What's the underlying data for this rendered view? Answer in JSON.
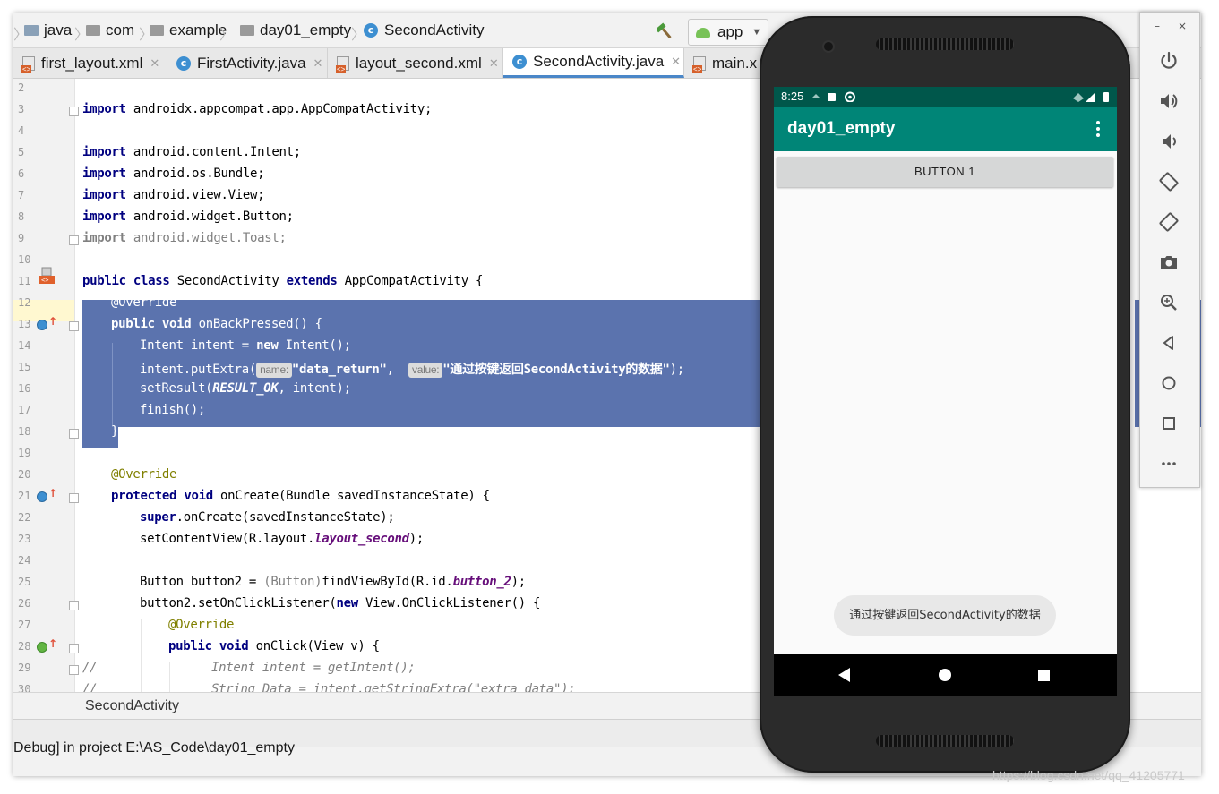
{
  "breadcrumb": [
    "java",
    "com",
    "example",
    "day01_empty",
    "SecondActivity"
  ],
  "run_config": "app",
  "tabs": [
    {
      "label": "first_layout.xml",
      "type": "xml"
    },
    {
      "label": "FirstActivity.java",
      "type": "class"
    },
    {
      "label": "layout_second.xml",
      "type": "xml"
    },
    {
      "label": "SecondActivity.java",
      "type": "class",
      "active": true
    },
    {
      "label": "main.x",
      "type": "xml"
    }
  ],
  "code": {
    "line_numbers": [
      "2",
      "3",
      "4",
      "5",
      "6",
      "7",
      "8",
      "9",
      "10",
      "11",
      "12",
      "13",
      "14",
      "15",
      "16",
      "17",
      "18",
      "19",
      "20",
      "21",
      "22",
      "23",
      "24",
      "25",
      "26",
      "27",
      "28",
      "29",
      "30"
    ],
    "l3": [
      "import",
      " androidx.appcompat.app.AppCompatActivity;"
    ],
    "l5": [
      "import",
      " android.content.Intent;"
    ],
    "l6": [
      "import",
      " android.os.Bundle;"
    ],
    "l7": [
      "import",
      " android.view.View;"
    ],
    "l8": [
      "import",
      " android.widget.Button;"
    ],
    "l9": [
      "import",
      " android.widget.Toast;"
    ],
    "l11": [
      "public",
      " ",
      "class",
      " SecondActivity ",
      "extends",
      " AppCompatActivity {"
    ],
    "l12": [
      "@Override"
    ],
    "l13": [
      "public",
      " ",
      "void",
      " onBackPressed() {"
    ],
    "l14": [
      "Intent intent = ",
      "new",
      " Intent();"
    ],
    "l15": [
      "intent.putExtra(",
      "name:",
      "\"data_return\"",
      ",  ",
      "value:",
      "\"通过按键返回SecondActivity的数据\"",
      ");"
    ],
    "l16": [
      "setResult(",
      "RESULT_OK",
      ", intent);"
    ],
    "l17": [
      "finish();"
    ],
    "l18": [
      "}"
    ],
    "l20": [
      "@Override"
    ],
    "l21": [
      "protected",
      " ",
      "void",
      " onCreate(Bundle savedInstanceState) {"
    ],
    "l22": [
      "super",
      ".onCreate(savedInstanceState);"
    ],
    "l23": [
      "setContentView(R.layout.",
      "layout_second",
      ");"
    ],
    "l25": [
      "Button button2 = ",
      "(Button)",
      "findViewById(R.id.",
      "button_2",
      ");"
    ],
    "l26": [
      "button2.setOnClickListener(",
      "new",
      " View.OnClickListener() {"
    ],
    "l27": [
      "@Override"
    ],
    "l28": [
      "public",
      " ",
      "void",
      " onClick(View v) {"
    ],
    "l29": [
      "//",
      "Intent intent = getIntent();"
    ],
    "l30": [
      "//",
      "String Data = intent.getStringExtra(\"extra_data\");"
    ]
  },
  "structure_breadcrumb": "SecondActivity",
  "console_text": "Debug] in project E:\\AS_Code\\day01_empty",
  "emulator": {
    "status_time": "8:25",
    "app_title": "day01_empty",
    "button_label": "BUTTON 1",
    "toast": "通过按键返回SecondActivity的数据",
    "window_controls": [
      "–",
      "×"
    ],
    "side_buttons": [
      "power-icon",
      "volume-up-icon",
      "volume-down-icon",
      "rotate-left-icon",
      "rotate-right-icon",
      "camera-icon",
      "zoom-icon",
      "back-icon",
      "home-icon",
      "overview-icon",
      "more-icon"
    ]
  },
  "watermark": "https://blog.csdn.net/qq_41205771",
  "colors": {
    "selection": "#5b73ae",
    "app_bar": "#008577",
    "status_bar": "#00574b"
  }
}
